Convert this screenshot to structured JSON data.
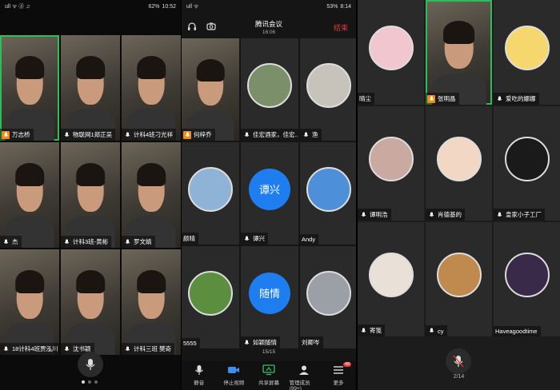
{
  "left_phone": {
    "status": {
      "left": "ull ᯤ ⓓ ♫",
      "battery": "62%",
      "time": "10:52"
    },
    "tiles": [
      {
        "name": "万志桥",
        "host": true,
        "kind": "video",
        "active": true
      },
      {
        "name": "物联网1郑正吴",
        "host": false,
        "kind": "video"
      },
      {
        "name": "计科4班刁光祥",
        "host": false,
        "kind": "video"
      },
      {
        "name": "杰",
        "host": false,
        "kind": "video"
      },
      {
        "name": "计科3班-黄彬",
        "host": false,
        "kind": "video"
      },
      {
        "name": "罗文婧",
        "host": false,
        "kind": "video"
      },
      {
        "name": "18计科4班贾泓川",
        "host": false,
        "kind": "video"
      },
      {
        "name": "沈书颖",
        "host": false,
        "kind": "video"
      },
      {
        "name": "计科三班 樊奇",
        "host": false,
        "kind": "video"
      }
    ]
  },
  "mid_phone": {
    "status": {
      "left": "ull ᯤ",
      "battery": "53%",
      "time": "8:14"
    },
    "meeting_title": "腾讯会议",
    "meeting_time": "16:06",
    "end_label": "结束",
    "tiles": [
      {
        "name": "何梓乔",
        "host": true,
        "kind": "video"
      },
      {
        "name": "佳宏酒家，佳宏...",
        "host": false,
        "kind": "avatar",
        "color": "#7a8f6a"
      },
      {
        "name": "渔",
        "host": false,
        "kind": "avatar",
        "color": "#c7c2ba"
      },
      {
        "name": "颜晴",
        "host": false,
        "kind": "avatar",
        "color": "#8fb3d6",
        "plain": true
      },
      {
        "name": "谭兴",
        "host": false,
        "kind": "blue",
        "label": "谭兴"
      },
      {
        "name": "Andy",
        "host": false,
        "kind": "avatar",
        "color": "#4d8fd9",
        "plain": true
      },
      {
        "name": "5555",
        "host": false,
        "kind": "avatar",
        "color": "#5b8f3f",
        "plain": true
      },
      {
        "name": "如颖随情",
        "host": false,
        "kind": "blue",
        "label": "随情"
      },
      {
        "name": "刘卿岑",
        "host": false,
        "kind": "avatar",
        "color": "#9aa0a6",
        "plain": true
      }
    ],
    "pager": "15/15",
    "toolbar": [
      {
        "label": "静音",
        "icon": "mic-icon"
      },
      {
        "label": "停止视频",
        "icon": "camera-icon"
      },
      {
        "label": "共享屏幕",
        "icon": "share-screen-icon"
      },
      {
        "label": "管理成员(99+)",
        "icon": "members-icon"
      },
      {
        "label": "更多",
        "icon": "more-icon",
        "badge": "48"
      }
    ]
  },
  "right_phone": {
    "tiles": [
      {
        "name": "晴尘",
        "host": false,
        "kind": "avatar",
        "color": "#f2c6cf",
        "plain": true
      },
      {
        "name": "张明晶",
        "host": true,
        "kind": "video",
        "active": true
      },
      {
        "name": "爱吃的娜娜",
        "host": false,
        "kind": "avatar",
        "color": "#f5d76e"
      },
      {
        "name": "谭明浩",
        "host": false,
        "kind": "avatar",
        "color": "#c9a9a0"
      },
      {
        "name": "肖德基的",
        "host": false,
        "kind": "avatar",
        "color": "#f1d7c4"
      },
      {
        "name": "皇家小子工厂",
        "host": false,
        "kind": "avatar",
        "color": "#1a1a1a"
      },
      {
        "name": "寄笺",
        "host": false,
        "kind": "avatar",
        "color": "#e9e0d8"
      },
      {
        "name": "cy",
        "host": false,
        "kind": "avatar",
        "color": "#c08a4f"
      },
      {
        "name": "Haveagoodtime",
        "host": false,
        "kind": "avatar",
        "color": "#3a2a4a",
        "plain": true
      }
    ],
    "pager": "2/14"
  }
}
